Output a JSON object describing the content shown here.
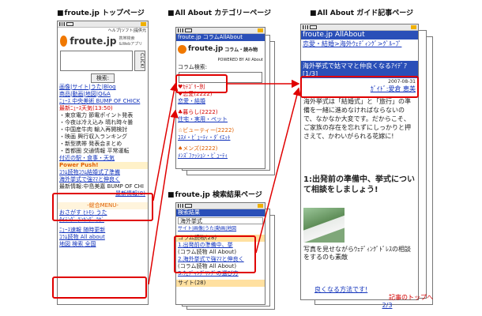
{
  "section_titles": {
    "top": "froute.jp トップページ",
    "category": "All About カテゴリーページ",
    "article": "All About ガイド記事ページ",
    "search": "froute.jp 検索結果ページ"
  },
  "top_page": {
    "logo_brand": "froute.jp",
    "logo_tagline": "携帯検索&Webアプリ",
    "header_right": "ヘルプ|ソフト|提供元",
    "search_button": "検索:",
    "check_button": "CLICK!",
    "nav_row1": [
      "画像",
      "サイト",
      "うた",
      "Blog"
    ],
    "nav_row2": [
      "商品",
      "動画",
      "地図",
      "Q&A"
    ],
    "lines": [
      "ﾆｭｰｽ 中央美術 BUMP OF CHICK",
      "最新ﾆｭｰｽ天気(13:50)",
      "・東京電力 節電ポイント発表",
      "・今夜は冷え込み 晴れ時々曇",
      "・中国産牛肉 輸入再開検討",
      "・映画 興行収入ランキング",
      "・新型携帯 発表会まとめ",
      "・首都圏 交通情報 平常運転",
      "付近の駅・食事・天気",
      "Power Push!",
      "ｺﾗﾑ読物ｺﾗﾑ結婚式了準備",
      "海外挙式で強ﾏﾏと伸良く",
      "最新情報:中島美嘉 BUMP OF CHI",
      "最新情報(8)"
    ],
    "general_menu": "-総合MENU-",
    "menu_rows": [
      [
        "おさがす",
        "ﾋﾄﾓｼ",
        "うた"
      ],
      [
        "ﾀｲﾐﾝｸﾞ",
        "ﾗﾝｷﾝｸﾞ",
        "ﾗﾎﾞ"
      ]
    ],
    "bottom_lines": [
      "ﾆｭｰｽ速報 随時更新",
      "ｺﾗﾑ読物 All about",
      "地図 検索 全国"
    ]
  },
  "category_page": {
    "header": "froute.jp コラムAllAbout",
    "logo_left": "froute.jp",
    "logo_right": "コラム・読み物",
    "powered": "POWERED BY All About",
    "search_label": "コラム検索:",
    "lines": [
      "♥恋愛(2222)",
      "恋愛・結婚",
      "♣暮らし(2222)",
      "住宅・実用・ペット",
      "☆ビューティー(2222)",
      "ｺｽﾒ・ﾋﾞｭｰﾃｨ・ﾀﾞｲｴｯﾄ",
      "♠メンズ(2222)",
      "ﾒﾝｽﾞﾌｧｯｼｮﾝ・ﾋﾞｭｰﾃｨ"
    ],
    "top_line": "♥ｶﾃｺﾞﾘｰ別"
  },
  "search_page": {
    "header": "検索結果",
    "query": "海外挙式",
    "tabs": "サイト|画像|うた|動画|地図",
    "result_head": "コラム読物(28)",
    "results": [
      "1.出発前の準備中、挙",
      "(コラム読物 All About)",
      "2.海外挙式で強ﾏﾏと伸良く",
      "(コラム読物 All About)",
      "3.ｳｪﾃﾞｨﾝｸﾞﾘﾝｸﾞの選び方"
    ],
    "extra": "サイト(28)"
  },
  "article_page": {
    "header": "froute.jp AllAbout",
    "breadcrumb": "恋愛・結婚>海外ｳｪﾃﾞｨﾝｸﾞ>ｸﾞﾙｰﾌﾟ",
    "title_bar": "海外挙式で姑ママと仲良くなるｱｲﾃﾞｱ [1/3]",
    "date": "2007-08-31",
    "guide": "ｶﾞｲﾄﾞ:愛倉 恵美",
    "intro": "海外挙式は「結婚式」と「旅行」の準備を一緒に進めなければならないので、なかなか大変です。だからこそ、ご家族の存在を忘れずにしっかりと押さえて、かわいがられる花嫁に!",
    "heading": "1:出発前の準備中、挙式について相談をしましょう!",
    "caption": "写真を見せながらｳｪﾃﾞｨﾝｸﾞﾄﾞﾚｽの相談をするのも素敵",
    "link1": "良くなる方法です!",
    "link2": "記事のトップへ",
    "page": "2/3"
  }
}
